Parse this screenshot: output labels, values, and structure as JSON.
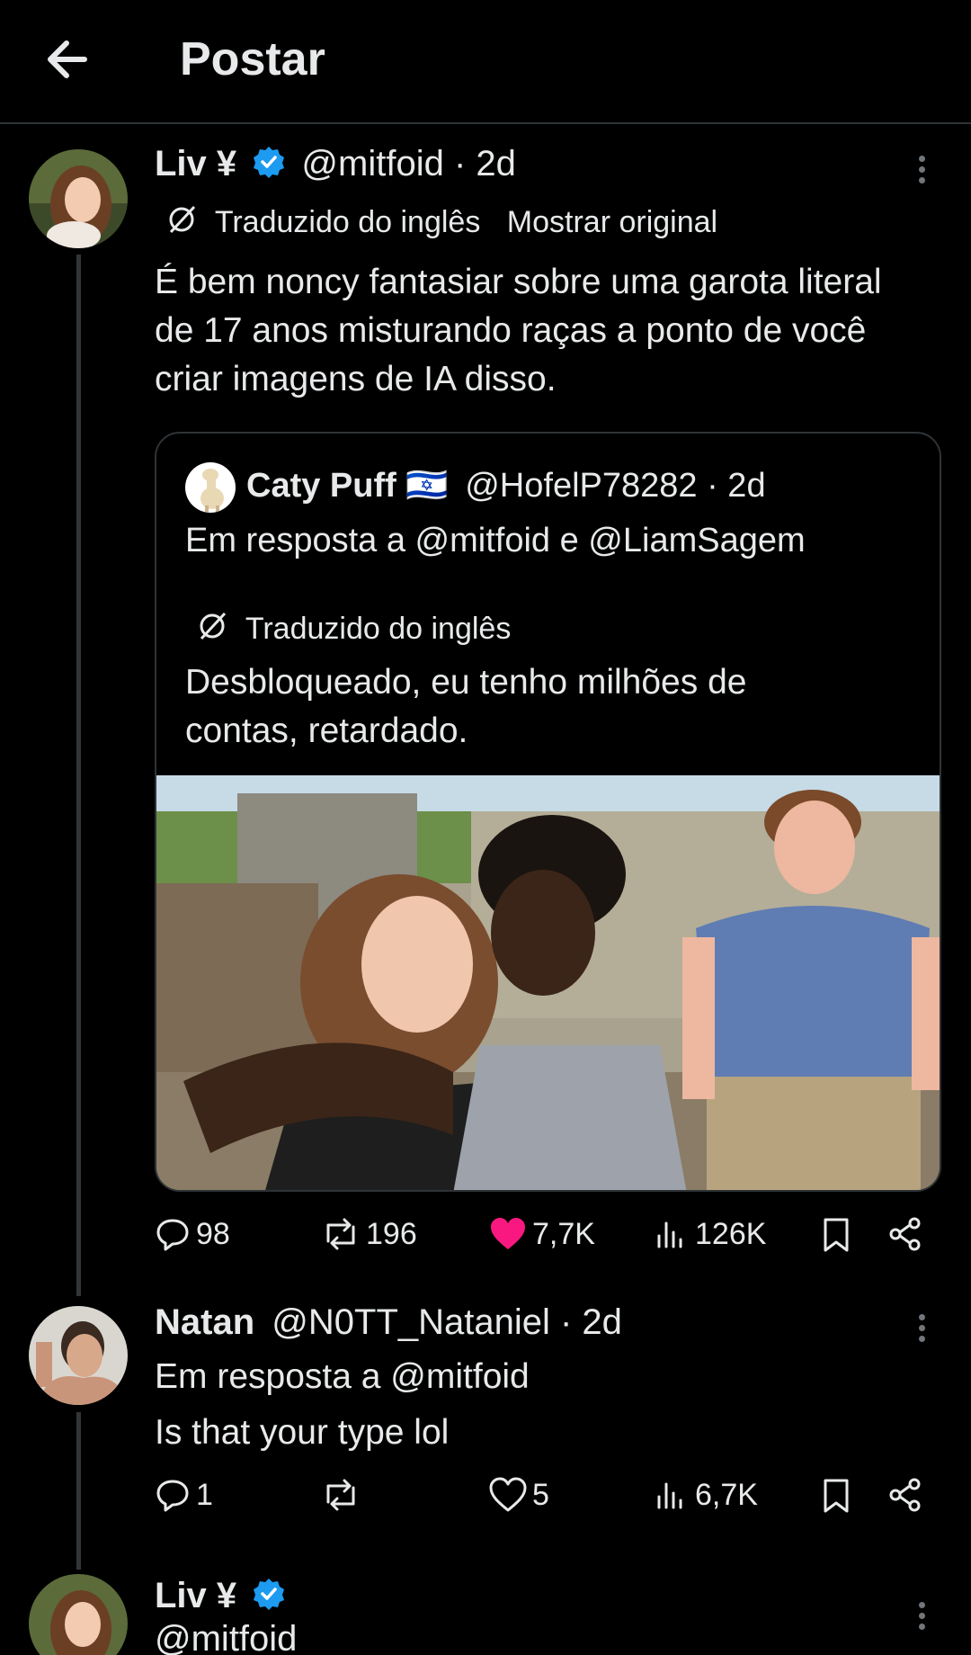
{
  "header": {
    "title": "Postar"
  },
  "main_post": {
    "name": "Liv ¥",
    "handle": "@mitfoid",
    "time": "· 2d",
    "translated_label": "Traduzido do inglês",
    "show_original": "Mostrar original",
    "text_lines": [
      "É bem noncy fantasiar sobre uma garota literal",
      "de 17 anos misturando raças a ponto de você",
      "criar imagens de IA disso."
    ],
    "quote": {
      "name": "Caty Puff 🇮🇱",
      "handle": "@HofelP78282 · 2d",
      "reply_to": "Em resposta a @mitfoid e @LiamSagem",
      "translated_label": "Traduzido do inglês",
      "text_lines": [
        "Desbloqueado, eu tenho milhões de",
        "contas, retardado."
      ]
    },
    "stats": {
      "replies": "98",
      "reposts": "196",
      "likes": "7,7K",
      "views": "126K"
    },
    "colors": {
      "verified": "#1d9bf0",
      "like": "#f91880"
    }
  },
  "reply_post": {
    "name": "Natan",
    "handle": "@N0TT_Nataniel · 2d",
    "reply_to": "Em resposta a @mitfoid",
    "text": "Is that your type lol",
    "stats": {
      "replies": "1",
      "likes": "5",
      "views": "6,7K"
    }
  },
  "next_post": {
    "name": "Liv ¥",
    "handle": "@mitfoid"
  }
}
